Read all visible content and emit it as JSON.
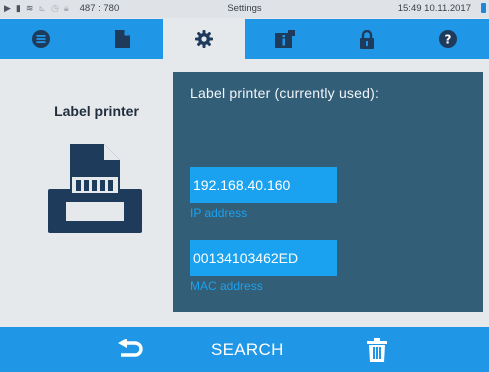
{
  "status_bar": {
    "icons": [
      "play-icon",
      "document-small-icon",
      "steam-icon",
      "chart-icon",
      "clock-icon",
      "lock-small-icon"
    ],
    "coords": "487 : 780",
    "title": "Settings",
    "time": "15:49",
    "date": "10.11.2017",
    "battery_color": "#1e88d8"
  },
  "tabs": [
    {
      "icon": "list-icon",
      "active": false
    },
    {
      "icon": "document-icon",
      "active": false
    },
    {
      "icon": "gear-icon",
      "active": true
    },
    {
      "icon": "info-book-icon",
      "active": false
    },
    {
      "icon": "lock-icon",
      "active": false
    },
    {
      "icon": "help-icon",
      "active": false
    }
  ],
  "left_pane": {
    "title": "Label printer",
    "icon": "label-printer-icon"
  },
  "panel": {
    "heading": "Label printer (currently used):",
    "ip": {
      "value": "192.168.40.160",
      "label": "IP address"
    },
    "mac": {
      "value": "00134103462ED",
      "label": "MAC address"
    }
  },
  "bottom_bar": {
    "back_icon": "back-arrow-icon",
    "search_label": "SEARCH",
    "trash_icon": "trash-icon"
  },
  "colors": {
    "accent": "#1f96e6",
    "panel": "#335e78",
    "field": "#1aa2f0",
    "icon_dark": "#1f3b5c"
  }
}
